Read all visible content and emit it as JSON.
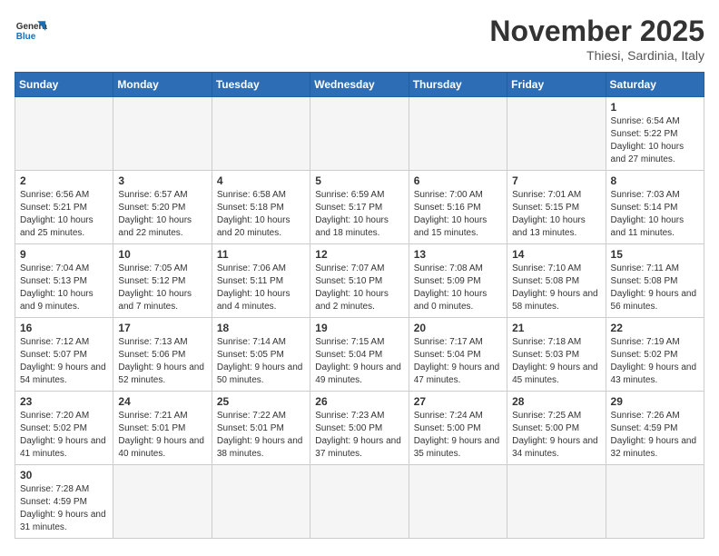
{
  "logo": {
    "general": "General",
    "blue": "Blue"
  },
  "header": {
    "month_year": "November 2025",
    "location": "Thiesi, Sardinia, Italy"
  },
  "weekdays": [
    "Sunday",
    "Monday",
    "Tuesday",
    "Wednesday",
    "Thursday",
    "Friday",
    "Saturday"
  ],
  "weeks": [
    [
      {
        "day": "",
        "info": ""
      },
      {
        "day": "",
        "info": ""
      },
      {
        "day": "",
        "info": ""
      },
      {
        "day": "",
        "info": ""
      },
      {
        "day": "",
        "info": ""
      },
      {
        "day": "",
        "info": ""
      },
      {
        "day": "1",
        "info": "Sunrise: 6:54 AM\nSunset: 5:22 PM\nDaylight: 10 hours and 27 minutes."
      }
    ],
    [
      {
        "day": "2",
        "info": "Sunrise: 6:56 AM\nSunset: 5:21 PM\nDaylight: 10 hours and 25 minutes."
      },
      {
        "day": "3",
        "info": "Sunrise: 6:57 AM\nSunset: 5:20 PM\nDaylight: 10 hours and 22 minutes."
      },
      {
        "day": "4",
        "info": "Sunrise: 6:58 AM\nSunset: 5:18 PM\nDaylight: 10 hours and 20 minutes."
      },
      {
        "day": "5",
        "info": "Sunrise: 6:59 AM\nSunset: 5:17 PM\nDaylight: 10 hours and 18 minutes."
      },
      {
        "day": "6",
        "info": "Sunrise: 7:00 AM\nSunset: 5:16 PM\nDaylight: 10 hours and 15 minutes."
      },
      {
        "day": "7",
        "info": "Sunrise: 7:01 AM\nSunset: 5:15 PM\nDaylight: 10 hours and 13 minutes."
      },
      {
        "day": "8",
        "info": "Sunrise: 7:03 AM\nSunset: 5:14 PM\nDaylight: 10 hours and 11 minutes."
      }
    ],
    [
      {
        "day": "9",
        "info": "Sunrise: 7:04 AM\nSunset: 5:13 PM\nDaylight: 10 hours and 9 minutes."
      },
      {
        "day": "10",
        "info": "Sunrise: 7:05 AM\nSunset: 5:12 PM\nDaylight: 10 hours and 7 minutes."
      },
      {
        "day": "11",
        "info": "Sunrise: 7:06 AM\nSunset: 5:11 PM\nDaylight: 10 hours and 4 minutes."
      },
      {
        "day": "12",
        "info": "Sunrise: 7:07 AM\nSunset: 5:10 PM\nDaylight: 10 hours and 2 minutes."
      },
      {
        "day": "13",
        "info": "Sunrise: 7:08 AM\nSunset: 5:09 PM\nDaylight: 10 hours and 0 minutes."
      },
      {
        "day": "14",
        "info": "Sunrise: 7:10 AM\nSunset: 5:08 PM\nDaylight: 9 hours and 58 minutes."
      },
      {
        "day": "15",
        "info": "Sunrise: 7:11 AM\nSunset: 5:08 PM\nDaylight: 9 hours and 56 minutes."
      }
    ],
    [
      {
        "day": "16",
        "info": "Sunrise: 7:12 AM\nSunset: 5:07 PM\nDaylight: 9 hours and 54 minutes."
      },
      {
        "day": "17",
        "info": "Sunrise: 7:13 AM\nSunset: 5:06 PM\nDaylight: 9 hours and 52 minutes."
      },
      {
        "day": "18",
        "info": "Sunrise: 7:14 AM\nSunset: 5:05 PM\nDaylight: 9 hours and 50 minutes."
      },
      {
        "day": "19",
        "info": "Sunrise: 7:15 AM\nSunset: 5:04 PM\nDaylight: 9 hours and 49 minutes."
      },
      {
        "day": "20",
        "info": "Sunrise: 7:17 AM\nSunset: 5:04 PM\nDaylight: 9 hours and 47 minutes."
      },
      {
        "day": "21",
        "info": "Sunrise: 7:18 AM\nSunset: 5:03 PM\nDaylight: 9 hours and 45 minutes."
      },
      {
        "day": "22",
        "info": "Sunrise: 7:19 AM\nSunset: 5:02 PM\nDaylight: 9 hours and 43 minutes."
      }
    ],
    [
      {
        "day": "23",
        "info": "Sunrise: 7:20 AM\nSunset: 5:02 PM\nDaylight: 9 hours and 41 minutes."
      },
      {
        "day": "24",
        "info": "Sunrise: 7:21 AM\nSunset: 5:01 PM\nDaylight: 9 hours and 40 minutes."
      },
      {
        "day": "25",
        "info": "Sunrise: 7:22 AM\nSunset: 5:01 PM\nDaylight: 9 hours and 38 minutes."
      },
      {
        "day": "26",
        "info": "Sunrise: 7:23 AM\nSunset: 5:00 PM\nDaylight: 9 hours and 37 minutes."
      },
      {
        "day": "27",
        "info": "Sunrise: 7:24 AM\nSunset: 5:00 PM\nDaylight: 9 hours and 35 minutes."
      },
      {
        "day": "28",
        "info": "Sunrise: 7:25 AM\nSunset: 5:00 PM\nDaylight: 9 hours and 34 minutes."
      },
      {
        "day": "29",
        "info": "Sunrise: 7:26 AM\nSunset: 4:59 PM\nDaylight: 9 hours and 32 minutes."
      }
    ],
    [
      {
        "day": "30",
        "info": "Sunrise: 7:28 AM\nSunset: 4:59 PM\nDaylight: 9 hours and 31 minutes."
      },
      {
        "day": "",
        "info": ""
      },
      {
        "day": "",
        "info": ""
      },
      {
        "day": "",
        "info": ""
      },
      {
        "day": "",
        "info": ""
      },
      {
        "day": "",
        "info": ""
      },
      {
        "day": "",
        "info": ""
      }
    ]
  ]
}
